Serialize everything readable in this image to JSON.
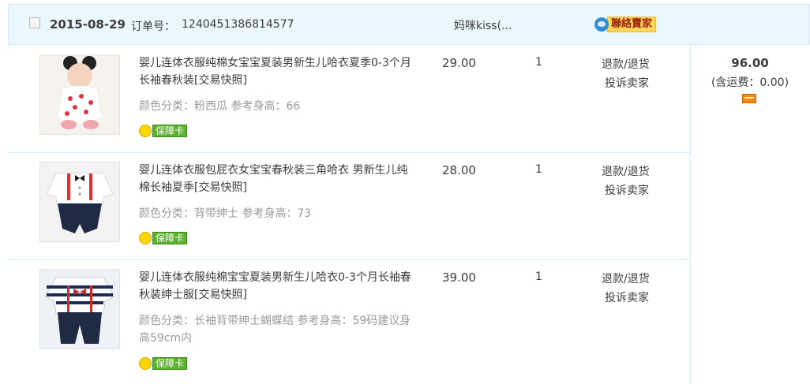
{
  "order": {
    "date": "2015-08-29",
    "order_no_label": "订单号：",
    "order_no": "1240451386814577",
    "shop_name": "妈咪kiss(...",
    "contact_label": "聯絡賣家",
    "total": "96.00",
    "shipping": "(含运费：0.00)"
  },
  "items": [
    {
      "title": "婴儿连体衣服纯棉女宝宝夏装男新生儿哈衣夏季0-3个月长袖春秋装[交易快照]",
      "spec": "颜色分类：粉西瓜  参考身高：66",
      "card": "保障卡",
      "price": "29.00",
      "qty": "1",
      "refund": "退款/退货",
      "complain": "投诉卖家"
    },
    {
      "title": "婴儿连体衣服包屁衣女宝宝春秋装三角哈衣 男新生儿纯棉长袖夏季[交易快照]",
      "spec": "颜色分类：背带绅士  参考身高：73",
      "card": "保障卡",
      "price": "28.00",
      "qty": "1",
      "refund": "退款/退货",
      "complain": "投诉卖家"
    },
    {
      "title": "婴儿连体衣服纯棉宝宝夏装男新生儿哈衣0-3个月长袖春秋装绅士服[交易快照]",
      "spec": "颜色分类：长袖背带绅士蝴蝶结  参考身高：59码建议身高59cm内",
      "card": "保障卡",
      "price": "39.00",
      "qty": "1",
      "refund": "退款/退货",
      "complain": "投诉卖家"
    }
  ],
  "colors": {
    "header_bg": "#eaf7ff",
    "border": "#d6ecf8",
    "muted_text": "#9a9a9a",
    "contact_button": "#fbd75a",
    "card_green": "#59b22c",
    "pay_icon": "#ef8b14"
  },
  "icons": {
    "checkbox": "checkbox-icon",
    "contact": "chat-bubble-icon",
    "card": "flower-badge-icon",
    "pay": "credit-card-icon"
  }
}
